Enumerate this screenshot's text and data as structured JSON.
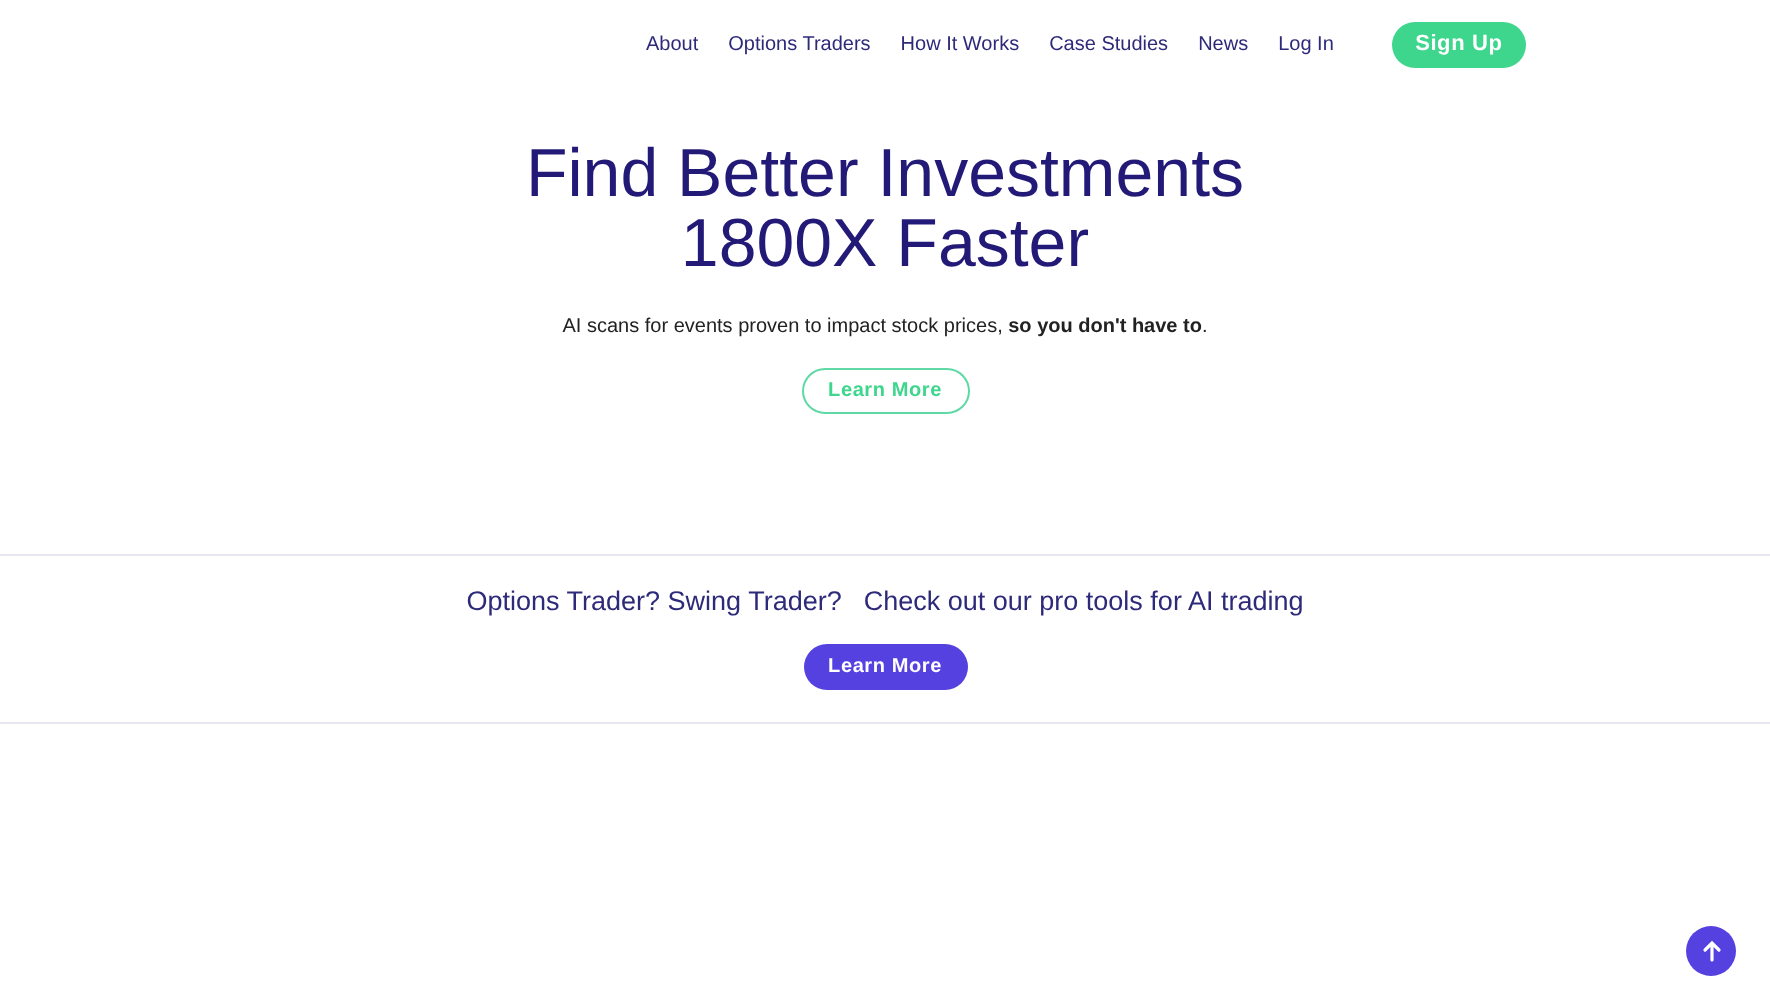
{
  "nav": {
    "links": [
      "About",
      "Options Traders",
      "How It Works",
      "Case Studies",
      "News",
      "Log In"
    ],
    "signup": "Sign Up"
  },
  "hero": {
    "title_lines": [
      "Find Better Investments",
      "1800X Faster"
    ],
    "subtitle": "AI scans for events proven to impact stock prices, **so you don't have to**.",
    "button": "Learn More"
  },
  "promo": {
    "texts": [
      "Options Trader? Swing Trader?",
      "Check out our pro tools for AI trading"
    ],
    "button": "Learn More"
  },
  "scroll_top": {
    "visible": true
  }
}
